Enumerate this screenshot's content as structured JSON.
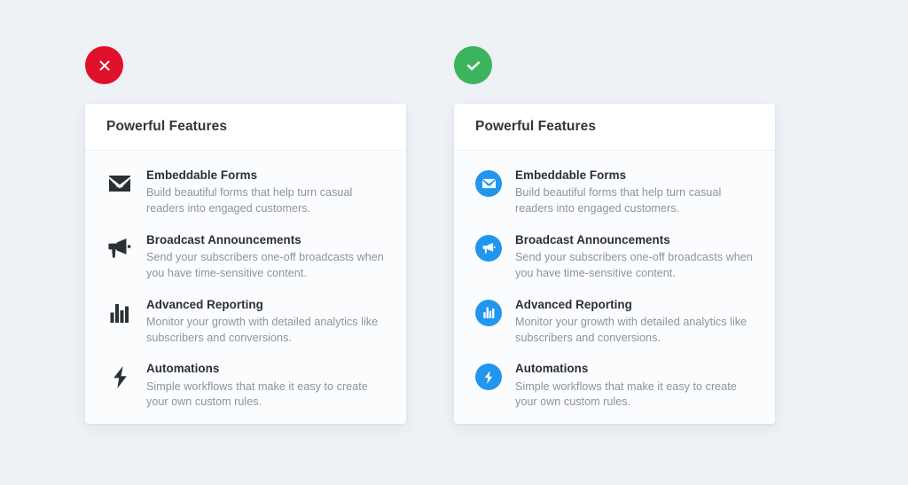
{
  "background_color": "#eef1f6",
  "panels": [
    {
      "id": "left",
      "badge": {
        "icon": "cross-circle-icon",
        "state": "error",
        "color": "#e0112a",
        "glyph_color": "#ffffff"
      },
      "card": {
        "title": "Powerful Features",
        "icon_style": "plain",
        "icon_color": "#2b2f36",
        "features": [
          {
            "icon": "envelope-icon",
            "title": "Embeddable Forms",
            "description": "Build beautiful forms that help turn casual readers into engaged customers."
          },
          {
            "icon": "megaphone-icon",
            "title": "Broadcast Announcements",
            "description": "Send your subscribers one-off broadcasts when you have time-sensitive content."
          },
          {
            "icon": "bar-chart-icon",
            "title": "Advanced Reporting",
            "description": "Monitor your growth with detailed analytics like subscribers and conversions."
          },
          {
            "icon": "lightning-bolt-icon",
            "title": "Automations",
            "description": "Simple workflows that make it easy to create your own custom rules."
          }
        ]
      }
    },
    {
      "id": "right",
      "badge": {
        "icon": "check-circle-icon",
        "state": "success",
        "color": "#3cb45c",
        "glyph_color": "#ffffff"
      },
      "card": {
        "title": "Powerful Features",
        "icon_style": "circled",
        "icon_color": "#2196ee",
        "features": [
          {
            "icon": "envelope-icon",
            "title": "Embeddable Forms",
            "description": "Build beautiful forms that help turn casual readers into engaged customers."
          },
          {
            "icon": "megaphone-icon",
            "title": "Broadcast Announcements",
            "description": "Send your subscribers one-off broadcasts when you have time-sensitive content."
          },
          {
            "icon": "bar-chart-icon",
            "title": "Advanced Reporting",
            "description": "Monitor your growth with detailed analytics like subscribers and conversions."
          },
          {
            "icon": "lightning-bolt-icon",
            "title": "Automations",
            "description": "Simple workflows that make it easy to create your own custom rules."
          }
        ]
      }
    }
  ]
}
